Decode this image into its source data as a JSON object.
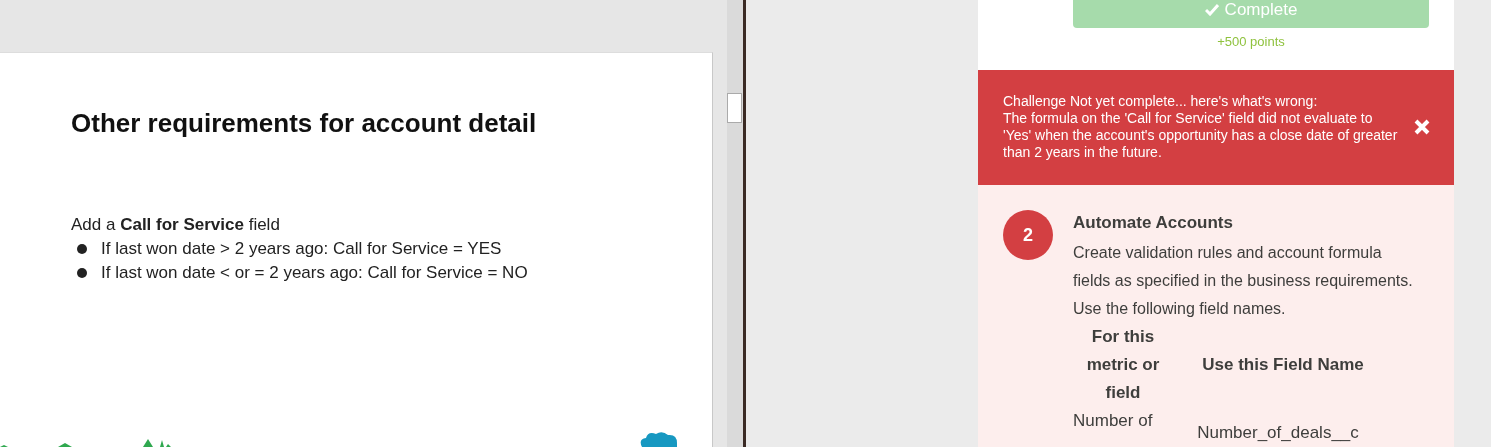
{
  "slide": {
    "title": "Other requirements for account detail",
    "intro": "Add a **Call for Service** field",
    "bullets": [
      "If last won date > 2 years ago: Call for Service = YES",
      "If last won date < or = 2 years ago: Call for Service = NO"
    ]
  },
  "challenge": {
    "button": {
      "label": "Complete",
      "disabled": true
    },
    "points": "+500 points"
  },
  "error": {
    "heading": "Challenge Not yet complete... here's what's wrong:",
    "message": "The formula on the 'Call for Service' field did not evaluate to 'Yes' when the account's opportunity has a close date of greater than 2 years in the future."
  },
  "step": {
    "number": "2",
    "title": "Automate Accounts",
    "description": "Create validation rules and account formula fields as specified in the business requirements. Use the following field names.",
    "table": {
      "columns": [
        "For this metric or field",
        "Use this Field Name"
      ],
      "rows": [
        [
          "Number of",
          "Number_of_deals__c"
        ]
      ]
    }
  }
}
